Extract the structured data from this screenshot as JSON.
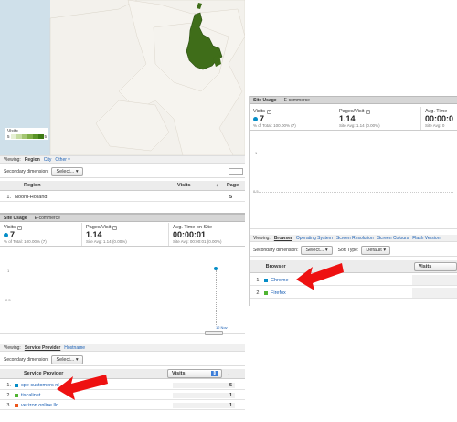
{
  "map": {
    "legend_title": "Visits",
    "legend_min": "5",
    "legend_max": "5",
    "legend_colors": [
      "#e6f0d4",
      "#c6dca2",
      "#a3c672",
      "#7fae47",
      "#5a9428",
      "#3d7a14"
    ],
    "highlight_color": "#3f6d19"
  },
  "region_panel": {
    "viewing_label": "Viewing:",
    "dims": [
      "Region",
      "City",
      "Other ▾"
    ],
    "secondary_label": "Secondary dimension:",
    "select_label": "Select... ▾",
    "col_region": "Region",
    "col_visits": "Visits",
    "col_pages": "Page",
    "sort_arrow": "↓",
    "rows": [
      {
        "num": "1.",
        "name": "Noord-Holland",
        "visits": "5"
      }
    ]
  },
  "sp_panel": {
    "tabs": [
      "Site Usage",
      "E-commerce"
    ],
    "metrics": [
      {
        "label": "Visits",
        "value": "7",
        "sub": "% of Total: 100.00% (7)"
      },
      {
        "label": "Pages/Visit",
        "value": "1.14",
        "sub": "Site Avg: 1.14 (0.00%)"
      },
      {
        "label": "Avg. Time on Site",
        "value": "00:00:01",
        "sub": "Site Avg: 00:00:01 (0.00%)"
      }
    ],
    "y_top": "1",
    "y_mid": "0.5",
    "x_label": "12 Nov",
    "viewing_label": "Viewing:",
    "dims": [
      "Service Provider",
      "Hostname"
    ],
    "secondary_label": "Secondary dimension:",
    "select_label": "Select... ▾",
    "col_name": "Service Provider",
    "col_metric": "Visits",
    "rows": [
      {
        "num": "1.",
        "name": "cpe customers nl",
        "value": "5",
        "color": "#058dc7"
      },
      {
        "num": "2.",
        "name": "tiscalinet",
        "value": "1",
        "color": "#50b432"
      },
      {
        "num": "3.",
        "name": "verizon online llc",
        "value": "1",
        "color": "#ed561b"
      }
    ]
  },
  "browser_panel": {
    "tabs": [
      "Site Usage",
      "E-commerce"
    ],
    "metrics": [
      {
        "label": "Visits",
        "value": "7",
        "sub": "% of Total: 100.00% (7)"
      },
      {
        "label": "Pages/Visit",
        "value": "1.14",
        "sub": "Site Avg: 1.14 (0.00%)"
      },
      {
        "label": "Avg. Time",
        "value": "00:00:0",
        "sub": "Site Avg: 0"
      }
    ],
    "y_top": "1",
    "y_mid": "0.5",
    "viewing_label": "Viewing:",
    "dims": [
      "Browser",
      "Operating System",
      "Screen Resolution",
      "Screen Colours",
      "Flash Version"
    ],
    "secondary_label": "Secondary dimension:",
    "select_label": "Select... ▾",
    "sort_label": "Sort Type:",
    "sort_value": "Default ▾",
    "col_name": "Browser",
    "col_metric": "Visits",
    "rows": [
      {
        "num": "1.",
        "name": "Chrome",
        "color": "#058dc7"
      },
      {
        "num": "2.",
        "name": "Firefox",
        "color": "#50b432"
      }
    ]
  },
  "annotations": {
    "arrow_color": "#ee1111"
  }
}
